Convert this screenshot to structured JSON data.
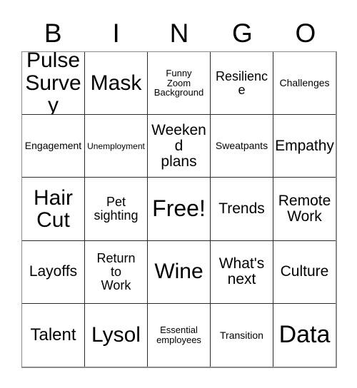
{
  "card": {
    "title": "BINGO",
    "header_letters": [
      "B",
      "I",
      "N",
      "G",
      "O"
    ],
    "free_space_label": "Free!",
    "colors": {
      "background": "#ffffff",
      "text": "#000000",
      "cell_border": "#2b2b2b",
      "outer_border": "#8a8a8a"
    },
    "rows": [
      [
        {
          "text": "Pulse\nSurvey",
          "size": "fs-3xl"
        },
        {
          "text": "Mask",
          "size": "fs-3xl"
        },
        {
          "text": "Funny\nZoom\nBackground",
          "size": "fs-sm"
        },
        {
          "text": "Resilience",
          "size": "fs-lg"
        },
        {
          "text": "Challenges",
          "size": "fs-md"
        }
      ],
      [
        {
          "text": "Engagement",
          "size": "fs-md"
        },
        {
          "text": "Unemployment",
          "size": "fs-xs"
        },
        {
          "text": "Weekend\nplans",
          "size": "fs-xl"
        },
        {
          "text": "Sweatpants",
          "size": "fs-md"
        },
        {
          "text": "Empathy",
          "size": "fs-xl"
        }
      ],
      [
        {
          "text": "Hair\nCut",
          "size": "fs-3xl"
        },
        {
          "text": "Pet\nsighting",
          "size": "fs-lg"
        },
        {
          "text": "Free!",
          "size": "fs-4xl"
        },
        {
          "text": "Trends",
          "size": "fs-xl"
        },
        {
          "text": "Remote\nWork",
          "size": "fs-xl"
        }
      ],
      [
        {
          "text": "Layoffs",
          "size": "fs-xl"
        },
        {
          "text": "Return\nto\nWork",
          "size": "fs-lg"
        },
        {
          "text": "Wine",
          "size": "fs-3xl"
        },
        {
          "text": "What's\nnext",
          "size": "fs-xl"
        },
        {
          "text": "Culture",
          "size": "fs-xl"
        }
      ],
      [
        {
          "text": "Talent",
          "size": "fs-2xl"
        },
        {
          "text": "Lysol",
          "size": "fs-3xl"
        },
        {
          "text": "Essential\nemployees",
          "size": "fs-sm"
        },
        {
          "text": "Transition",
          "size": "fs-md"
        },
        {
          "text": "Data",
          "size": "fs-5xl"
        }
      ]
    ]
  }
}
